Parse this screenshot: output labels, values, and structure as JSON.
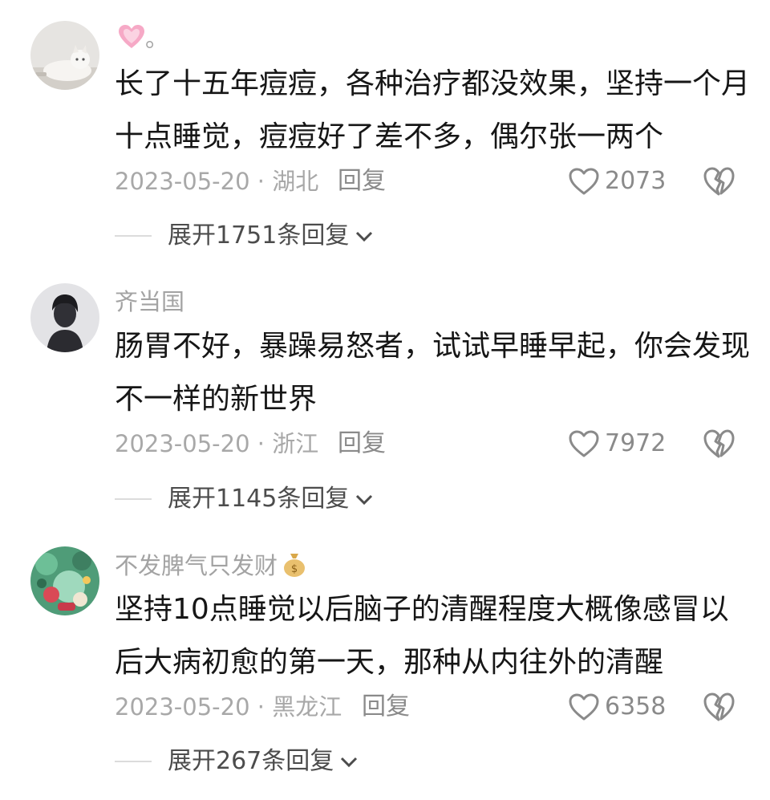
{
  "comments": [
    {
      "username": "",
      "username_emoji": "pink-heart-icon",
      "username_suffix": "。",
      "content_lines": [
        "长了十五年痘痘，各种治疗都没效果，坚持一个月",
        "十点睡觉，痘痘好了差不多，偶尔张一两个"
      ],
      "date_location": "2023-05-20 · 湖北",
      "reply_label": "回复",
      "likes": "2073",
      "expand_label": "展开1751条回复",
      "avatar": "cat-avatar"
    },
    {
      "username": "齐当国",
      "content_lines": [
        "肠胃不好，暴躁易怒者，试试早睡早起，你会发现",
        "不一样的新世界"
      ],
      "date_location": "2023-05-20 · 浙江",
      "reply_label": "回复",
      "likes": "7972",
      "expand_label": "展开1145条回复",
      "avatar": "silhouette-avatar"
    },
    {
      "username": "不发脾气只发财",
      "username_emoji": "money-bag-icon",
      "content_lines": [
        "坚持10点睡觉以后脑子的清醒程度大概像感冒以",
        "后大病初愈的第一天，那种从内往外的清醒"
      ],
      "date_location": "2023-05-20 · 黑龙江",
      "reply_label": "回复",
      "likes": "6358",
      "expand_label": "展开267条回复",
      "avatar": "green-illustration-avatar"
    }
  ],
  "colors": {
    "text_main": "#161616",
    "text_muted": "#a8a8a8",
    "icon_gray": "#8a8a8a",
    "heart_pink": "#f6a9c6"
  }
}
